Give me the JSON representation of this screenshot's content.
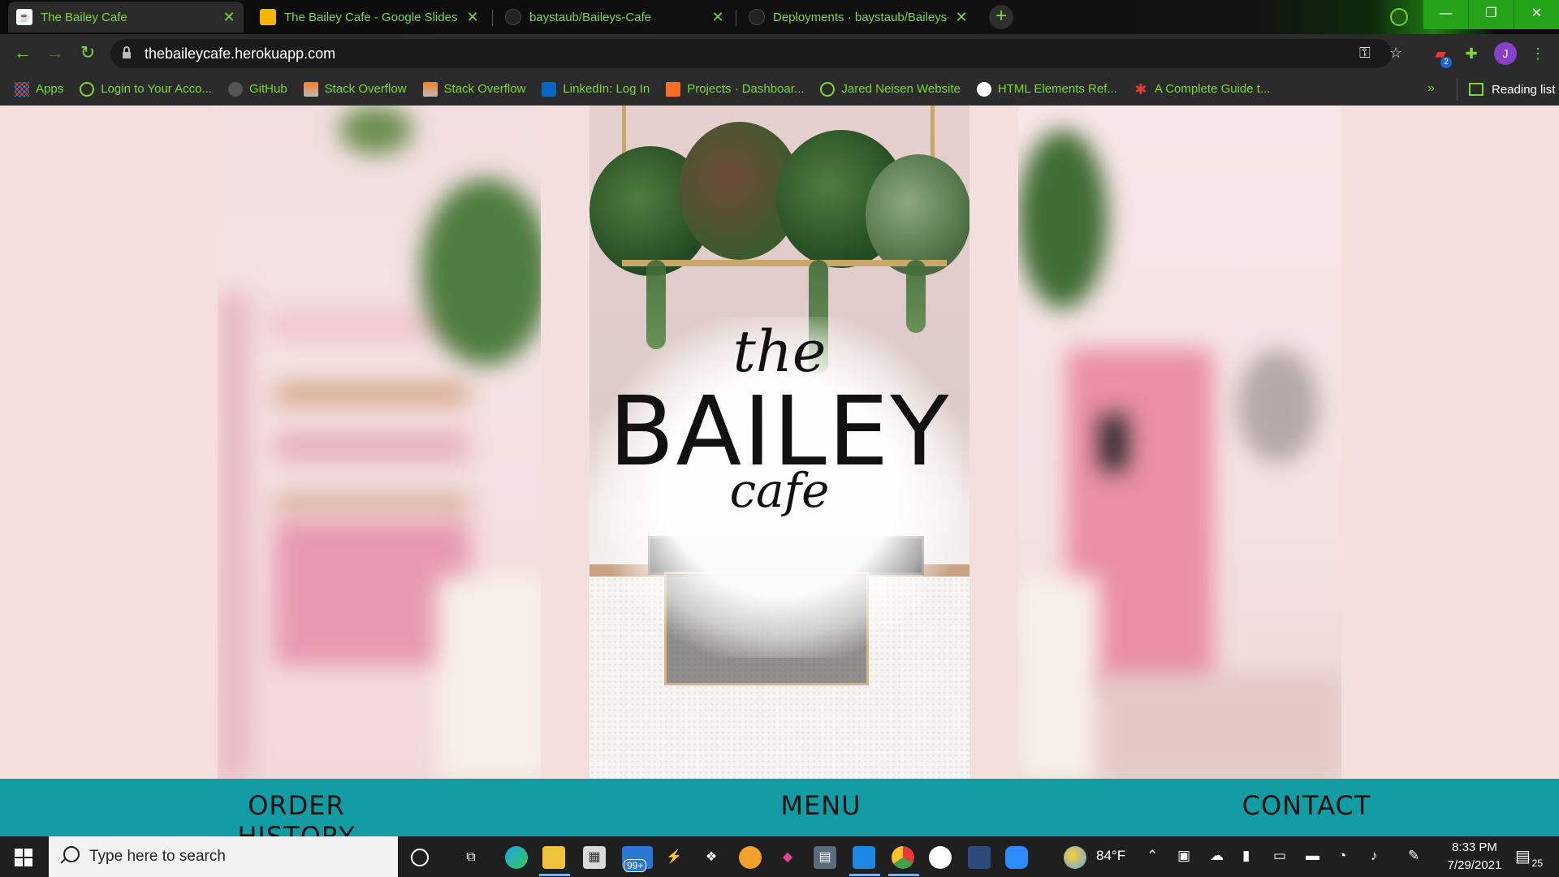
{
  "browser": {
    "tabs": [
      {
        "title": "The Bailey Cafe",
        "active": true,
        "icon": "cafe-favicon"
      },
      {
        "title": "The Bailey Cafe - Google Slides",
        "active": false,
        "icon": "slides-icon"
      },
      {
        "title": "baystaub/Baileys-Cafe",
        "active": false,
        "icon": "github-icon"
      },
      {
        "title": "Deployments · baystaub/Baileys-",
        "active": false,
        "icon": "github-icon"
      }
    ],
    "new_tab_label": "+",
    "url": "thebaileycafe.herokuapp.com",
    "profile_initial": "J",
    "extension_badge": "2",
    "bookmarks": [
      {
        "label": "Apps",
        "icon": "apps-grid-icon"
      },
      {
        "label": "Login to Your Acco...",
        "icon": "globe-icon"
      },
      {
        "label": "GitHub",
        "icon": "github-icon"
      },
      {
        "label": "Stack Overflow",
        "icon": "stackoverflow-icon"
      },
      {
        "label": "Stack Overflow",
        "icon": "stackoverflow-icon"
      },
      {
        "label": "LinkedIn: Log In",
        "icon": "linkedin-icon"
      },
      {
        "label": "Projects · Dashboar...",
        "icon": "gitlab-icon"
      },
      {
        "label": "Jared Neisen Website",
        "icon": "globe-icon"
      },
      {
        "label": "HTML Elements Ref...",
        "icon": "mdn-icon"
      },
      {
        "label": "A Complete Guide t...",
        "icon": "asterisk-icon"
      }
    ],
    "bookmarks_more": "»",
    "reading_list": "Reading list",
    "accent_color": "#7dd63a"
  },
  "page": {
    "logo": {
      "line1": "the",
      "line2": "BAILEY",
      "line3": "cafe"
    },
    "nav": {
      "order_history": "ORDER HISTORY",
      "menu": "MENU",
      "contact": "CONTACT"
    },
    "background_color": "#f3dfdd",
    "nav_color": "#139ca3"
  },
  "taskbar": {
    "search_placeholder": "Type here to search",
    "mail_badge": "99+",
    "weather": "84°F",
    "time": "8:33 PM",
    "date": "7/29/2021",
    "notifications": "25"
  }
}
